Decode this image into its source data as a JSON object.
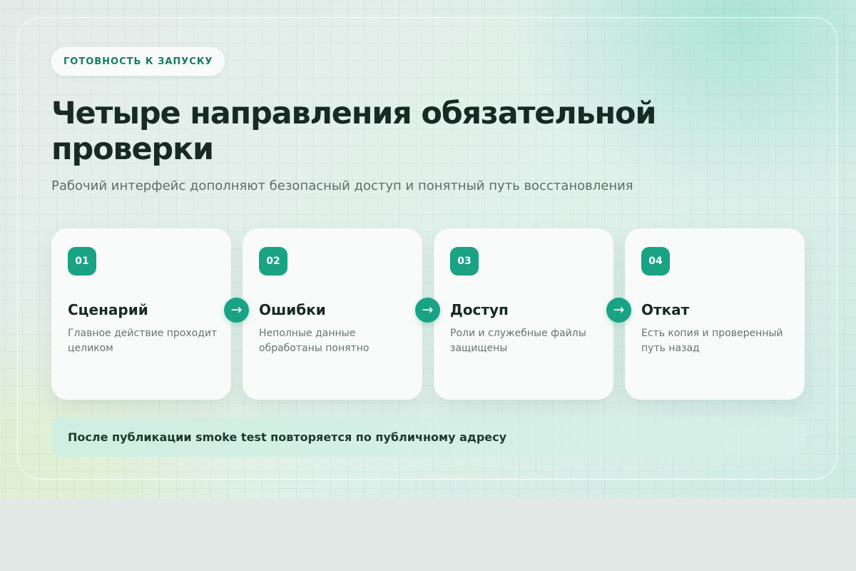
{
  "eyebrow": "ГОТОВНОСТЬ К ЗАПУСКУ",
  "title": "Четыре направления обязательной проверки",
  "subtitle": "Рабочий интерфейс дополняют безопасный доступ и понятный путь восстановления",
  "cards": [
    {
      "number": "01",
      "title": "Сценарий",
      "description": "Главное действие проходит целиком"
    },
    {
      "number": "02",
      "title": "Ошибки",
      "description": "Неполные данные обработаны понятно"
    },
    {
      "number": "03",
      "title": "Доступ",
      "description": "Роли и служебные файлы защищены"
    },
    {
      "number": "04",
      "title": "Откат",
      "description": "Есть копия и проверенный путь назад"
    }
  ],
  "arrow_icon": "arrow-right-icon",
  "arrow_glyph": "→",
  "note": "После публикации smoke test повторяется по публичному адресу",
  "colors": {
    "accent": "#19a384",
    "eyebrow_text": "#187a62",
    "heading": "#172a24",
    "muted_text": "#66746f",
    "note_background": "#d3efe5"
  }
}
